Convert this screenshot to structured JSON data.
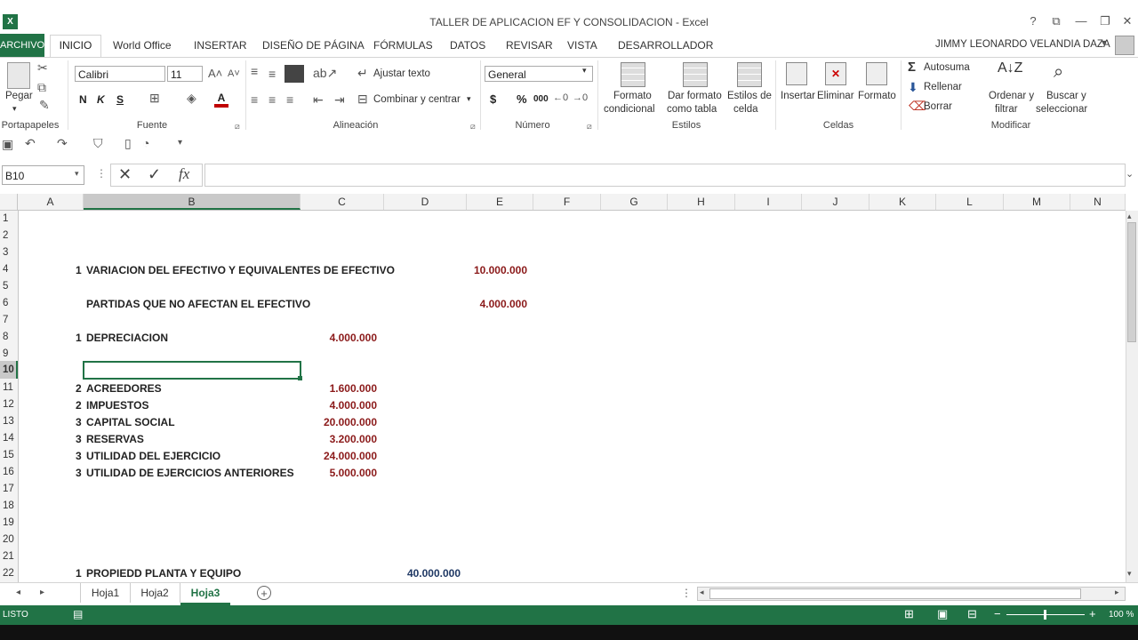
{
  "window": {
    "title": "TALLER DE APLICACION EF Y CONSOLIDACION - Excel",
    "help_glyph": "?",
    "ribbon_opts_glyph": "⧉",
    "minimize_glyph": "—",
    "restore_glyph": "❐",
    "close_glyph": "✕",
    "user": "JIMMY LEONARDO VELANDIA DAZA"
  },
  "tabs": [
    "ARCHIVO",
    "INICIO",
    "World Office",
    "INSERTAR",
    "DISEÑO DE PÁGINA",
    "FÓRMULAS",
    "DATOS",
    "REVISAR",
    "VISTA",
    "DESARROLLADOR"
  ],
  "ribbon": {
    "clipboard": {
      "paste": "Pegar",
      "label": "Portapapeles"
    },
    "font": {
      "name": "Calibri",
      "size": "11",
      "bold": "N",
      "italic": "K",
      "underline": "S",
      "label": "Fuente"
    },
    "alignment": {
      "wrap": "Ajustar texto",
      "merge": "Combinar y centrar",
      "label": "Alineación"
    },
    "number": {
      "format": "General",
      "currency": "$",
      "percent": "%",
      "thousands": "000",
      "label": "Número"
    },
    "styles": {
      "cond1": "Formato",
      "cond2": "condicional",
      "table1": "Dar formato",
      "table2": "como tabla",
      "cell1": "Estilos de",
      "cell2": "celda",
      "label": "Estilos"
    },
    "cells": {
      "insert": "Insertar",
      "delete": "Eliminar",
      "format": "Formato",
      "label": "Celdas"
    },
    "editing": {
      "autosum": "Autosuma",
      "fill": "Rellenar",
      "clear": "Borrar",
      "sort1": "Ordenar y",
      "sort2": "filtrar",
      "find1": "Buscar y",
      "find2": "seleccionar",
      "label": "Modificar"
    }
  },
  "formula_bar": {
    "name_box": "B10",
    "value": "",
    "fx": "fx"
  },
  "columns": [
    "A",
    "B",
    "C",
    "D",
    "E",
    "F",
    "G",
    "H",
    "I",
    "J",
    "K",
    "L",
    "M",
    "N"
  ],
  "rows": [
    "1",
    "2",
    "3",
    "4",
    "5",
    "6",
    "7",
    "8",
    "9",
    "10",
    "11",
    "12",
    "13",
    "14",
    "15",
    "16",
    "17",
    "18",
    "19",
    "20",
    "21",
    "22"
  ],
  "cells": {
    "r4": {
      "a": "1",
      "b": "VARIACION DEL EFECTIVO Y EQUIVALENTES DE EFECTIVO",
      "e": "10.000.000"
    },
    "r6": {
      "b": "PARTIDAS QUE NO AFECTAN EL EFECTIVO",
      "e": "4.000.000"
    },
    "r8": {
      "a": "1",
      "b": "DEPRECIACION",
      "c": "4.000.000"
    },
    "r11": {
      "a": "2",
      "b": "ACREEDORES",
      "c": "1.600.000"
    },
    "r12": {
      "a": "2",
      "b": "IMPUESTOS",
      "c": "4.000.000"
    },
    "r13": {
      "a": "3",
      "b": "CAPITAL SOCIAL",
      "c": "20.000.000"
    },
    "r14": {
      "a": "3",
      "b": "RESERVAS",
      "c": "3.200.000"
    },
    "r15": {
      "a": "3",
      "b": "UTILIDAD DEL EJERCICIO",
      "c": "24.000.000"
    },
    "r16": {
      "a": "3",
      "b": "UTILIDAD DE EJERCICIOS ANTERIORES",
      "c": "5.000.000"
    },
    "r22": {
      "a": "1",
      "b": "PROPIEDD PLANTA Y EQUIPO",
      "d": "40.000.000"
    }
  },
  "sheets": [
    "Hoja1",
    "Hoja2",
    "Hoja3"
  ],
  "active_sheet": "Hoja3",
  "status": {
    "mode": "LISTO",
    "zoom": "100 %"
  },
  "colors": {
    "excel_green": "#217346",
    "value_red": "#8b1a1a"
  }
}
